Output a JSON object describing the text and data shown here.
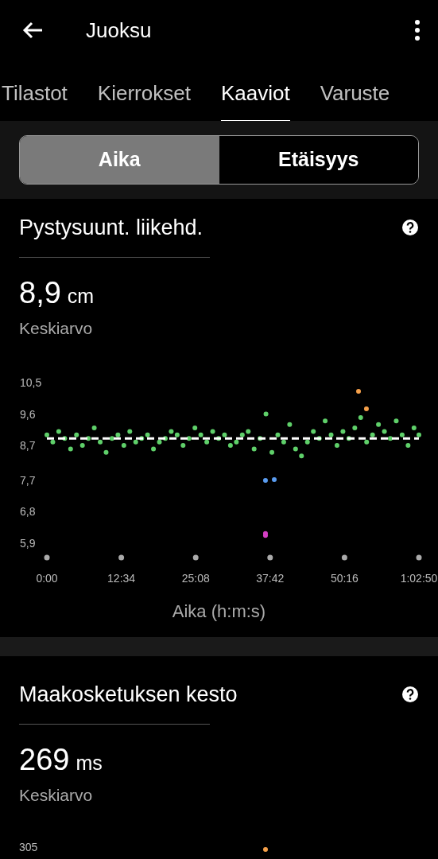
{
  "header": {
    "title": "Juoksu"
  },
  "tabs": [
    {
      "label": "Tilastot",
      "selected": false
    },
    {
      "label": "Kierrokset",
      "selected": false
    },
    {
      "label": "Kaaviot",
      "selected": true
    },
    {
      "label": "Varuste",
      "selected": false
    }
  ],
  "segments": [
    {
      "label": "Aika",
      "selected": true
    },
    {
      "label": "Etäisyys",
      "selected": false
    }
  ],
  "sections": [
    {
      "title": "Pystysuunt. liikehd.",
      "value": "8,9",
      "unit": "cm",
      "caption": "Keskiarvo",
      "chart_data": {
        "type": "scatter",
        "xlabel": "Aika (h:m:s)",
        "xlim": [
          0,
          3770
        ],
        "ylim": [
          5.9,
          10.5
        ],
        "xticks": [
          {
            "value": 0,
            "label": "0:00"
          },
          {
            "value": 754,
            "label": "12:34"
          },
          {
            "value": 1508,
            "label": "25:08"
          },
          {
            "value": 2262,
            "label": "37:42"
          },
          {
            "value": 3016,
            "label": "50:16"
          },
          {
            "value": 3770,
            "label": "1:02:50"
          }
        ],
        "yticks": [
          {
            "value": 10.5,
            "label": "10,5"
          },
          {
            "value": 9.6,
            "label": "9,6"
          },
          {
            "value": 8.7,
            "label": "8,7"
          },
          {
            "value": 7.7,
            "label": "7,7"
          },
          {
            "value": 6.8,
            "label": "6,8"
          },
          {
            "value": 5.9,
            "label": "5,9"
          }
        ],
        "series": [
          {
            "color": "#5fd06a",
            "x": [
              0,
              60,
              120,
              180,
              240,
              300,
              360,
              420,
              480,
              540,
              600,
              660,
              720,
              780,
              840,
              900,
              960,
              1020,
              1080,
              1140,
              1200,
              1260,
              1320,
              1380,
              1440,
              1500,
              1560,
              1620,
              1680,
              1740,
              1800,
              1860,
              1920,
              1980,
              2040,
              2100,
              2160,
              2220,
              2280,
              2340,
              2400,
              2460,
              2520,
              2580,
              2640,
              2700,
              2760,
              2820,
              2880,
              2940,
              3000,
              3060,
              3120,
              3180,
              3240,
              3300,
              3360,
              3420,
              3480,
              3540,
              3600,
              3660,
              3720,
              3770
            ],
            "values": [
              9.0,
              8.8,
              9.1,
              8.9,
              8.6,
              9.0,
              8.7,
              8.9,
              9.2,
              8.8,
              8.5,
              8.9,
              9.0,
              8.7,
              9.1,
              8.8,
              8.9,
              9.0,
              8.6,
              8.8,
              8.9,
              9.1,
              9.0,
              8.7,
              8.9,
              9.2,
              9.0,
              8.8,
              9.1,
              8.9,
              9.0,
              8.7,
              8.8,
              9.0,
              9.1,
              8.6,
              8.9,
              9.6,
              8.5,
              9.0,
              8.8,
              9.3,
              8.6,
              8.4,
              8.8,
              9.1,
              8.9,
              9.4,
              9.0,
              8.7,
              9.1,
              8.9,
              9.2,
              9.5,
              8.8,
              9.0,
              9.3,
              9.1,
              8.9,
              9.4,
              9.0,
              8.7,
              9.2,
              9.0
            ]
          },
          {
            "color": "#5a9cf0",
            "x": [
              2215,
              2304
            ],
            "values": [
              7.7,
              7.72
            ]
          },
          {
            "color": "#d43fc4",
            "x": [
              2215,
              2215
            ],
            "values": [
              6.12,
              6.18
            ]
          },
          {
            "color": "#f5a04a",
            "x": [
              3158,
              3238
            ],
            "values": [
              10.25,
              9.75
            ]
          }
        ],
        "ref_lines": [
          {
            "axis": "y",
            "value": 8.9
          }
        ]
      }
    },
    {
      "title": "Maakosketuksen kesto",
      "value": "269",
      "unit": "ms",
      "caption": "Keskiarvo",
      "chart_preview": {
        "tick_label": "305",
        "points": [
          {
            "color": "#f5a04a"
          }
        ]
      }
    }
  ]
}
